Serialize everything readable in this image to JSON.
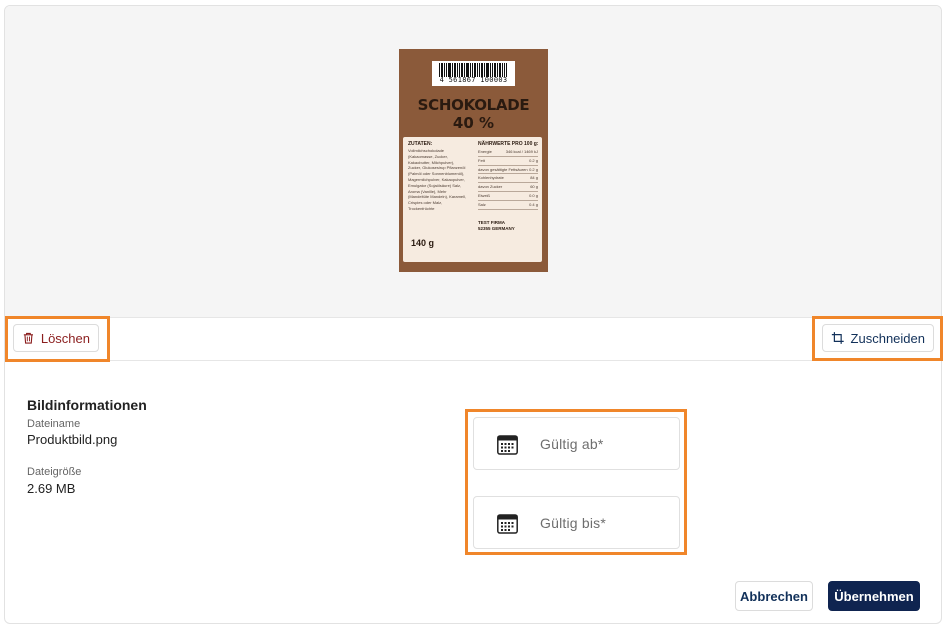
{
  "product_label": {
    "barcode_number": "4 561867 100003",
    "product_name": "SCHOKOLADE",
    "product_percent": "40 %",
    "ingredients_heading": "ZUTATEN:",
    "ingredients_text": "Vollmilchschokolade (Kakaomasse, Zucker, Kakaobutter, Milchpulver), Zucker, Glukosesirup Pflanzenöl (Palmöl oder Sonnenblumenöl), Magermilchpulver, Kakaopulver, Emulgator (Sojaölsäure) Salz, Aroma (Vanille), Mehr (Mandeltüte Mandeln), Karamell, Crispies oder Malz, Trockenfrüchte",
    "weight": "140 g",
    "nutrition_heading": "NÄHRWERTE PRO 100 g:",
    "nutrition_rows": [
      {
        "name": "Energie",
        "value": "346 kcal / 1469 kJ"
      },
      {
        "name": "Fett",
        "value": "0.2 g"
      },
      {
        "name": "davon gesättigte Fettsäuren",
        "value": "0.2 g"
      },
      {
        "name": "Kohlenhydrate",
        "value": "84 g"
      },
      {
        "name": "davon Zucker",
        "value": "60 g"
      },
      {
        "name": "Eiweiß",
        "value": "0.0 g"
      },
      {
        "name": "Salz",
        "value": "0.4 g"
      }
    ],
    "company_name": "TEST FIRMA",
    "company_address": "52355 GERMANY"
  },
  "toolbar": {
    "delete_label": "Löschen",
    "crop_label": "Zuschneiden"
  },
  "info": {
    "title": "Bildinformationen",
    "filename_label": "Dateiname",
    "filename_value": "Produktbild.png",
    "filesize_label": "Dateigröße",
    "filesize_value": "2.69 MB"
  },
  "dates": {
    "valid_from_placeholder": "Gültig ab*",
    "valid_to_placeholder": "Gültig bis*"
  },
  "footer": {
    "cancel_label": "Abbrechen",
    "apply_label": "Übernehmen"
  },
  "colors": {
    "highlight": "#f0862a",
    "primary": "#0f2450",
    "danger": "#8b1e1e",
    "label_brown": "#8b5a3a"
  }
}
